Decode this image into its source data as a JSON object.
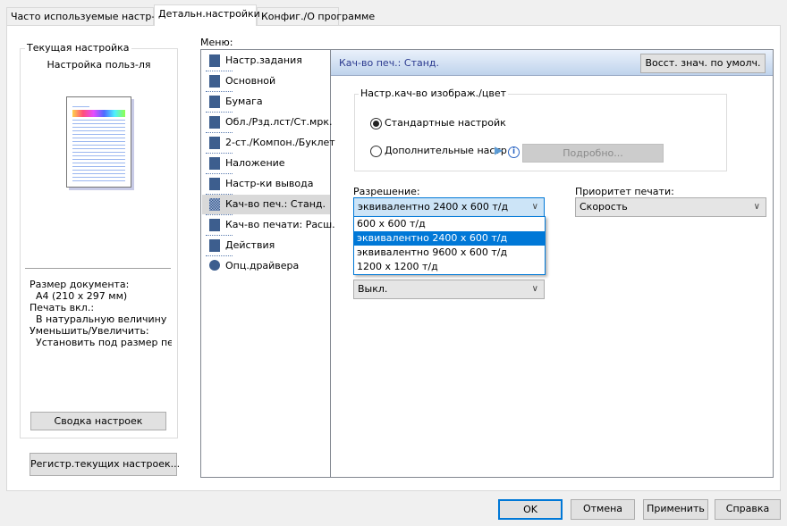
{
  "tabs": [
    {
      "label": "Часто используемые настр-ки"
    },
    {
      "label": "Детальн.настройки",
      "selected": true
    },
    {
      "label": "Конфиг./О программе"
    }
  ],
  "current": {
    "title": "Текущая настройка",
    "profile": "Настройка польз-ля",
    "doc_size_label": "Размер документа:",
    "doc_size": "A4 (210 x 297 мм)",
    "print_on_label": "Печать вкл.:",
    "print_on": "В натуральную величину",
    "zoom_label": "Уменьшить/Увеличить:",
    "zoom": "Установить под размер печат",
    "summary_button": "Сводка настроек",
    "register_button": "Регистр.текущих настроек..."
  },
  "menu": {
    "label": "Меню:",
    "items": [
      {
        "label": "Настр.задания",
        "icon": "job-settings-icon"
      },
      {
        "label": "Основной",
        "icon": "basic-icon"
      },
      {
        "label": "Бумага",
        "icon": "paper-icon"
      },
      {
        "label": "Обл./Рзд.лст/Ст.мрк.",
        "icon": "cover-icon"
      },
      {
        "label": "2-ст./Компон./Буклет",
        "icon": "duplex-icon"
      },
      {
        "label": "Наложение",
        "icon": "overlay-icon"
      },
      {
        "label": "Настр-ки вывода",
        "icon": "output-icon"
      },
      {
        "label": "Кач-во печ.: Станд.",
        "icon": "quality-icon",
        "selected": true
      },
      {
        "label": "Кач-во печати: Расш.",
        "icon": "quality-advanced-icon"
      },
      {
        "label": "Действия",
        "icon": "actions-icon"
      },
      {
        "label": "Опц.драйвера",
        "icon": "gear-icon"
      }
    ]
  },
  "main": {
    "header": "Кач-во печ.: Станд.",
    "restore_button": "Восст. знач. по умолч.",
    "group_title": "Настр.кач-во изображ./цвет",
    "radio_standard": "Стандартные настройк",
    "radio_additional": "Дополнительные настр",
    "details_button": "Подробно...",
    "resolution_label": "Разрешение:",
    "resolution_value": "эквивалентно 2400 x 600 т/д",
    "resolution_options": [
      "600 x 600 т/д",
      "эквивалентно 2400 x 600 т/д",
      "эквивалентно 9600 x 600 т/д",
      "1200 x 1200 т/д"
    ],
    "priority_label": "Приоритет печати:",
    "priority_value": "Скорость",
    "color_value": "Выкл."
  },
  "footer": {
    "ok": "OK",
    "cancel": "Отмена",
    "apply": "Применить",
    "help": "Справка"
  },
  "colors": {
    "accent": "#0078d7",
    "header_text": "#2b3a8f",
    "icon": "#3d5e8e"
  }
}
